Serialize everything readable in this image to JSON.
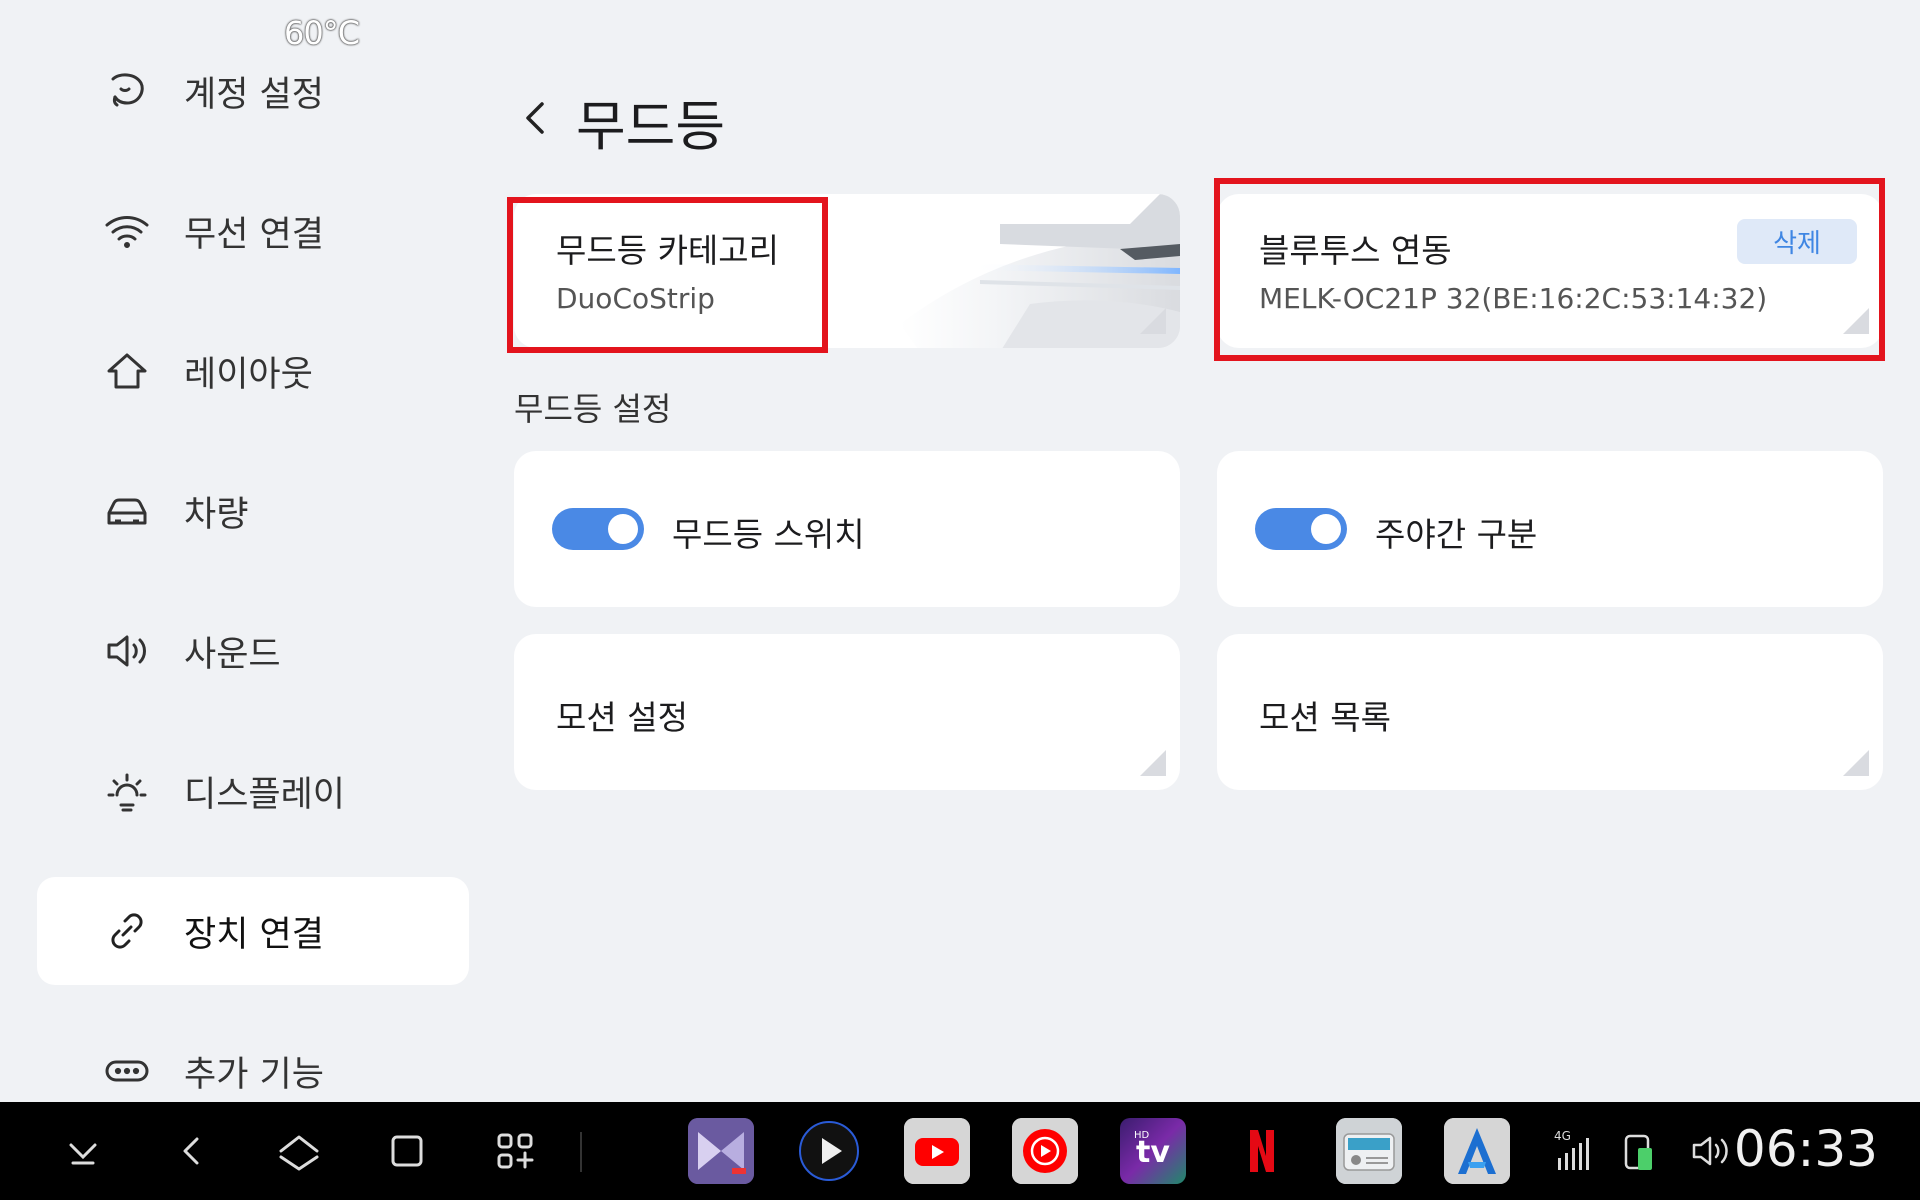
{
  "status": {
    "temperature": "60°C",
    "time": "06:33",
    "network": "4G"
  },
  "sidebar": {
    "items": [
      {
        "id": "account",
        "label": "계정 설정",
        "icon": "account-icon"
      },
      {
        "id": "wireless",
        "label": "무선 연결",
        "icon": "wifi-icon"
      },
      {
        "id": "layout",
        "label": "레이아웃",
        "icon": "home-icon"
      },
      {
        "id": "vehicle",
        "label": "차량",
        "icon": "car-icon"
      },
      {
        "id": "sound",
        "label": "사운드",
        "icon": "speaker-icon"
      },
      {
        "id": "display",
        "label": "디스플레이",
        "icon": "sun-icon"
      },
      {
        "id": "device",
        "label": "장치 연결",
        "icon": "link-icon",
        "active": true
      },
      {
        "id": "extra",
        "label": "추가 기능",
        "icon": "more-icon"
      }
    ]
  },
  "header": {
    "title": "무드등"
  },
  "category_card": {
    "title": "무드등 카테고리",
    "value": "DuoCoStrip"
  },
  "bluetooth_card": {
    "title": "블루투스 연동",
    "device": "MELK-OC21P  32(BE:16:2C:53:14:32)",
    "delete_label": "삭제"
  },
  "settings": {
    "section_label": "무드등 설정",
    "mood_switch": {
      "label": "무드등 스위치",
      "on": true
    },
    "day_night": {
      "label": "주야간 구분",
      "on": true
    },
    "motion_settings": {
      "label": "모션 설정"
    },
    "motion_list": {
      "label": "모션 목록"
    }
  },
  "colors": {
    "accent": "#4a89e5",
    "highlight": "#e3141d",
    "taskbar": "#000000",
    "background": "#f0f2f5"
  },
  "taskbar": {
    "nav": [
      "chevron-down-icon",
      "back-icon",
      "home-diamond-icon",
      "recents-icon",
      "apps-grid-icon"
    ],
    "apps": [
      "video-player-app",
      "play-app",
      "youtube-app",
      "youtube-music-app",
      "hd-tv-app",
      "netflix-app",
      "radio-app",
      "navigation-app"
    ],
    "status_icons": [
      "signal-icon",
      "battery-icon",
      "volume-icon"
    ]
  }
}
